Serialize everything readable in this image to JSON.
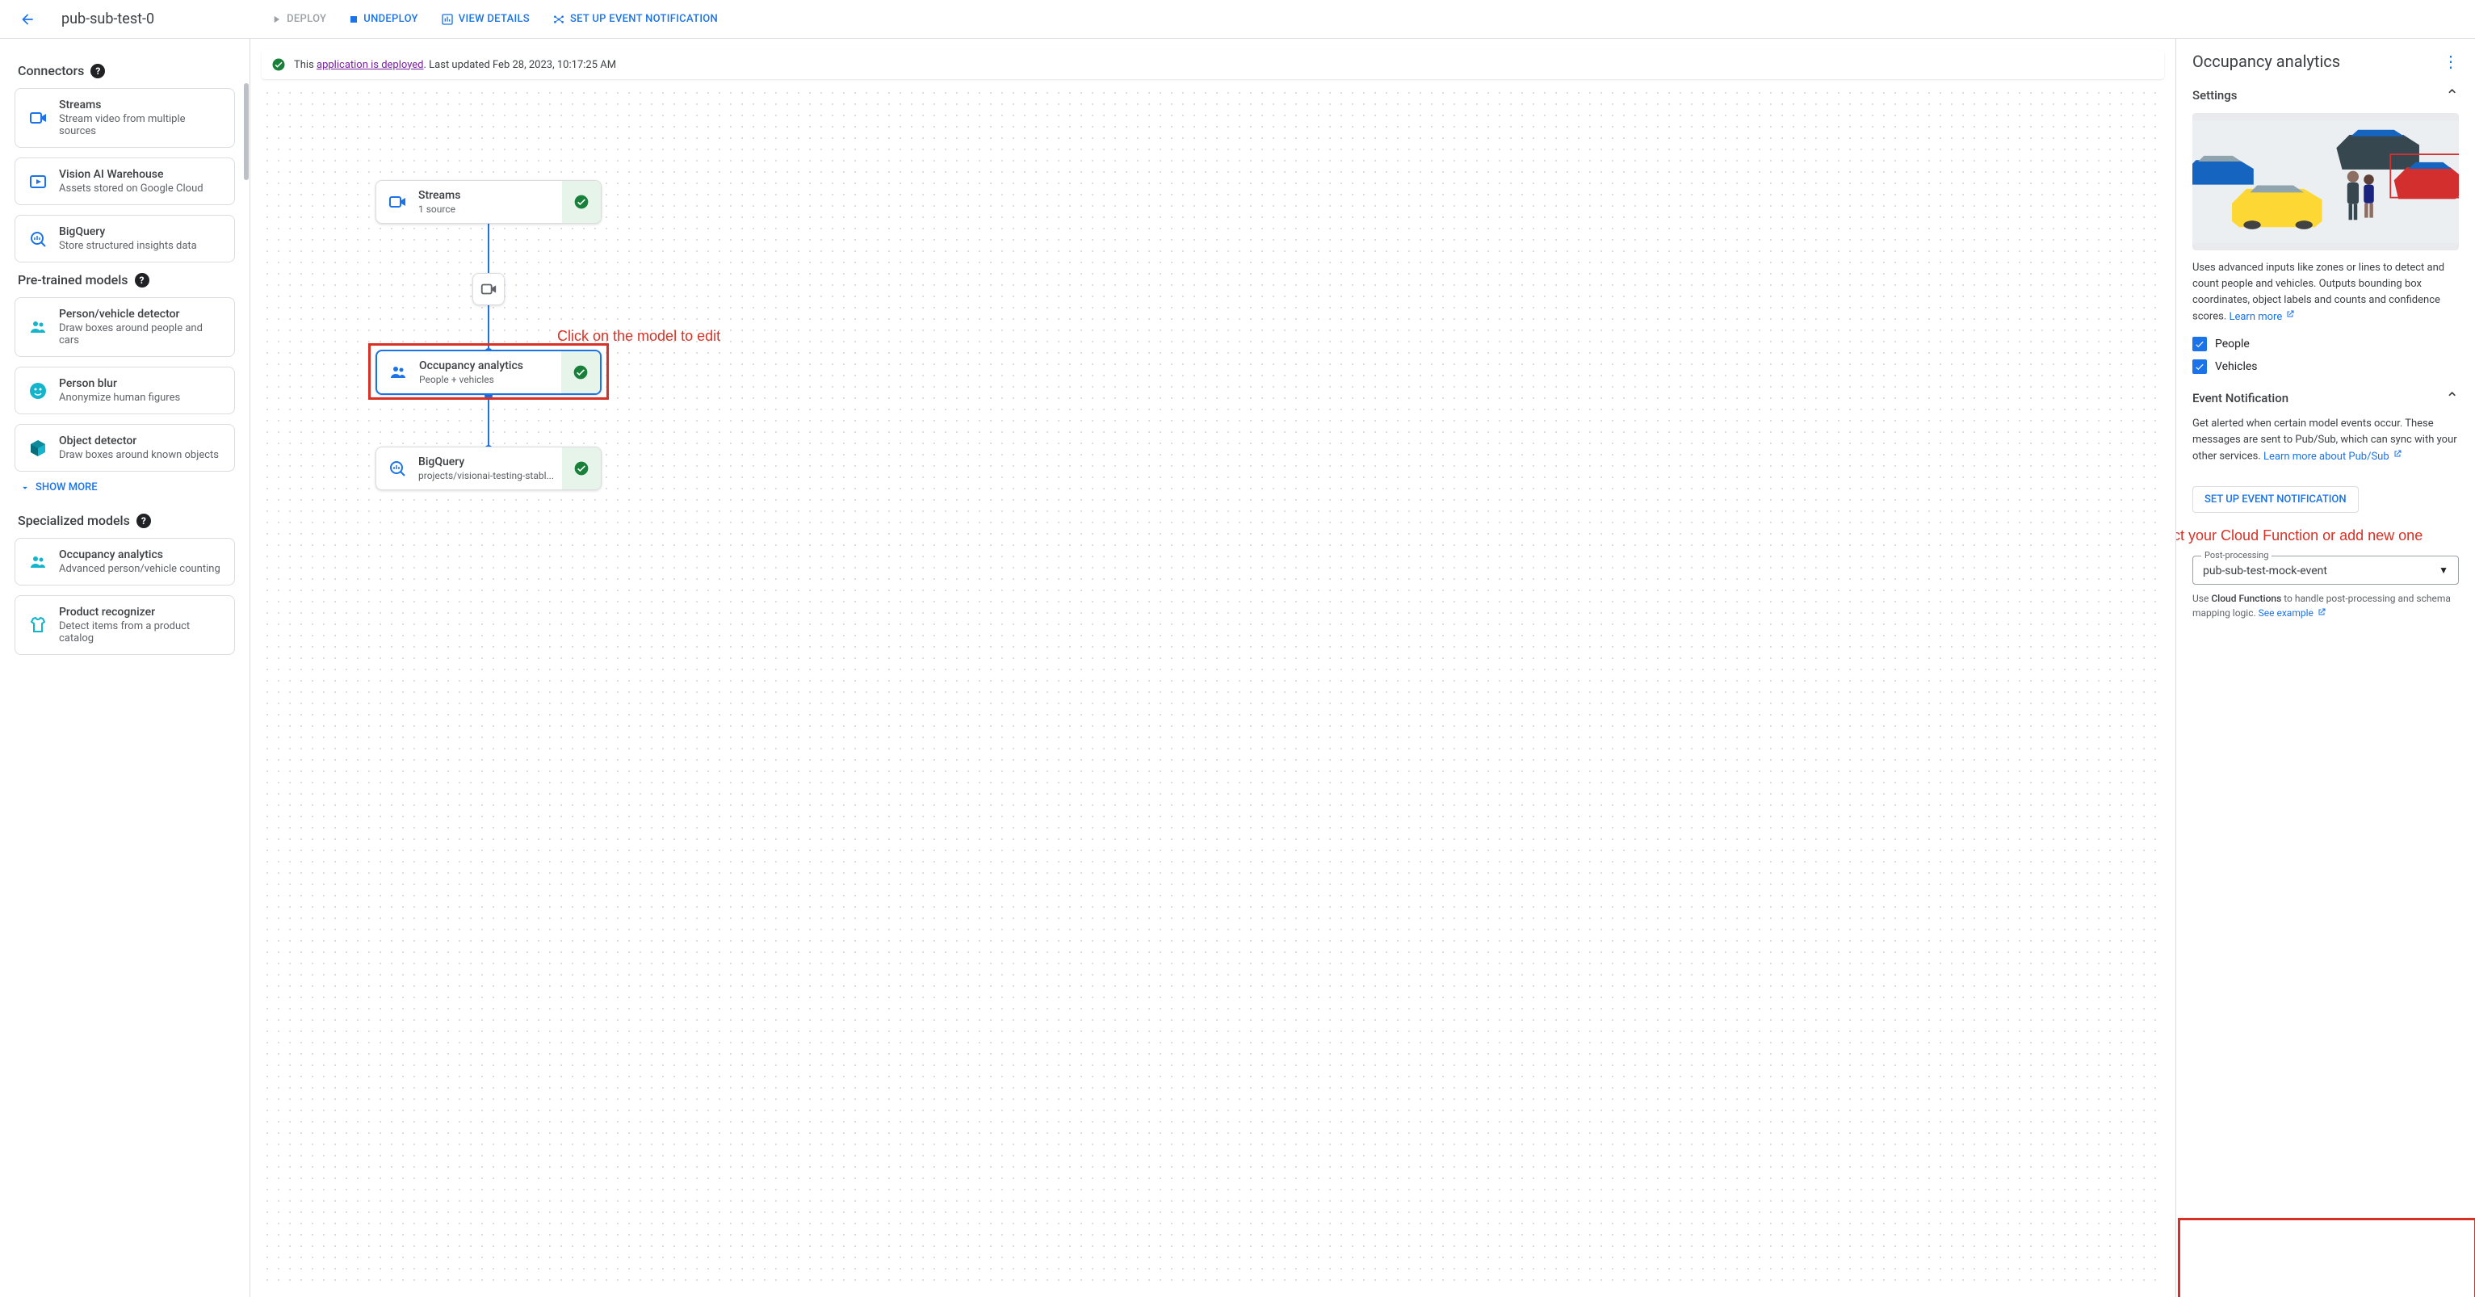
{
  "header": {
    "title": "pub-sub-test-0",
    "deploy": "DEPLOY",
    "undeploy": "UNDEPLOY",
    "viewDetails": "VIEW DETAILS",
    "setupEvent": "SET UP EVENT NOTIFICATION"
  },
  "status": {
    "prefix": "This ",
    "link": "application is deployed",
    "suffix": ". Last updated Feb 28, 2023, 10:17:25 AM"
  },
  "sidebar": {
    "connectors": {
      "title": "Connectors",
      "items": [
        {
          "title": "Streams",
          "subtitle": "Stream video from multiple sources",
          "icon": "video"
        },
        {
          "title": "Vision AI Warehouse",
          "subtitle": "Assets stored on Google Cloud",
          "icon": "play"
        },
        {
          "title": "BigQuery",
          "subtitle": "Store structured insights data",
          "icon": "bq"
        }
      ]
    },
    "pretrained": {
      "title": "Pre-trained models",
      "items": [
        {
          "title": "Person/vehicle detector",
          "subtitle": "Draw boxes around people and cars",
          "icon": "people"
        },
        {
          "title": "Person blur",
          "subtitle": "Anonymize human figures",
          "icon": "face"
        },
        {
          "title": "Object detector",
          "subtitle": "Draw boxes around known objects",
          "icon": "cube"
        }
      ],
      "showMore": "SHOW MORE"
    },
    "specialized": {
      "title": "Specialized models",
      "items": [
        {
          "title": "Occupancy analytics",
          "subtitle": "Advanced person/vehicle counting",
          "icon": "people"
        },
        {
          "title": "Product recognizer",
          "subtitle": "Detect items from a product catalog",
          "icon": "shirt"
        }
      ]
    }
  },
  "graph": {
    "nodes": {
      "streams": {
        "title": "Streams",
        "subtitle": "1 source"
      },
      "occupancy": {
        "title": "Occupancy analytics",
        "subtitle": "People + vehicles"
      },
      "bigquery": {
        "title": "BigQuery",
        "subtitle": "projects/visionai-testing-stabl..."
      }
    },
    "annotations": {
      "editModel": "Click on the model to edit",
      "selectCF": "Select your Cloud Function or add new one"
    }
  },
  "panel": {
    "title": "Occupancy analytics",
    "settings": {
      "title": "Settings",
      "desc": "Uses advanced inputs like zones or lines to detect and count people and vehicles. Outputs bounding box coordinates, object labels and counts and confidence scores. ",
      "learnMore": "Learn more",
      "chkPeople": "People",
      "chkVehicles": "Vehicles"
    },
    "event": {
      "title": "Event Notification",
      "desc1": "Get alerted when certain model events occur. These messages are sent to Pub/Sub, which can sync with your other services. ",
      "learnPubSub": "Learn more about Pub/Sub",
      "setupBtn": "SET UP EVENT NOTIFICATION",
      "selectLabel": "Post-processing",
      "selectValue": "pub-sub-test-mock-event",
      "hint1": "Use ",
      "hint2": "Cloud Functions",
      "hint3": " to handle post-processing and schema mapping logic. ",
      "seeExample": "See example"
    }
  }
}
